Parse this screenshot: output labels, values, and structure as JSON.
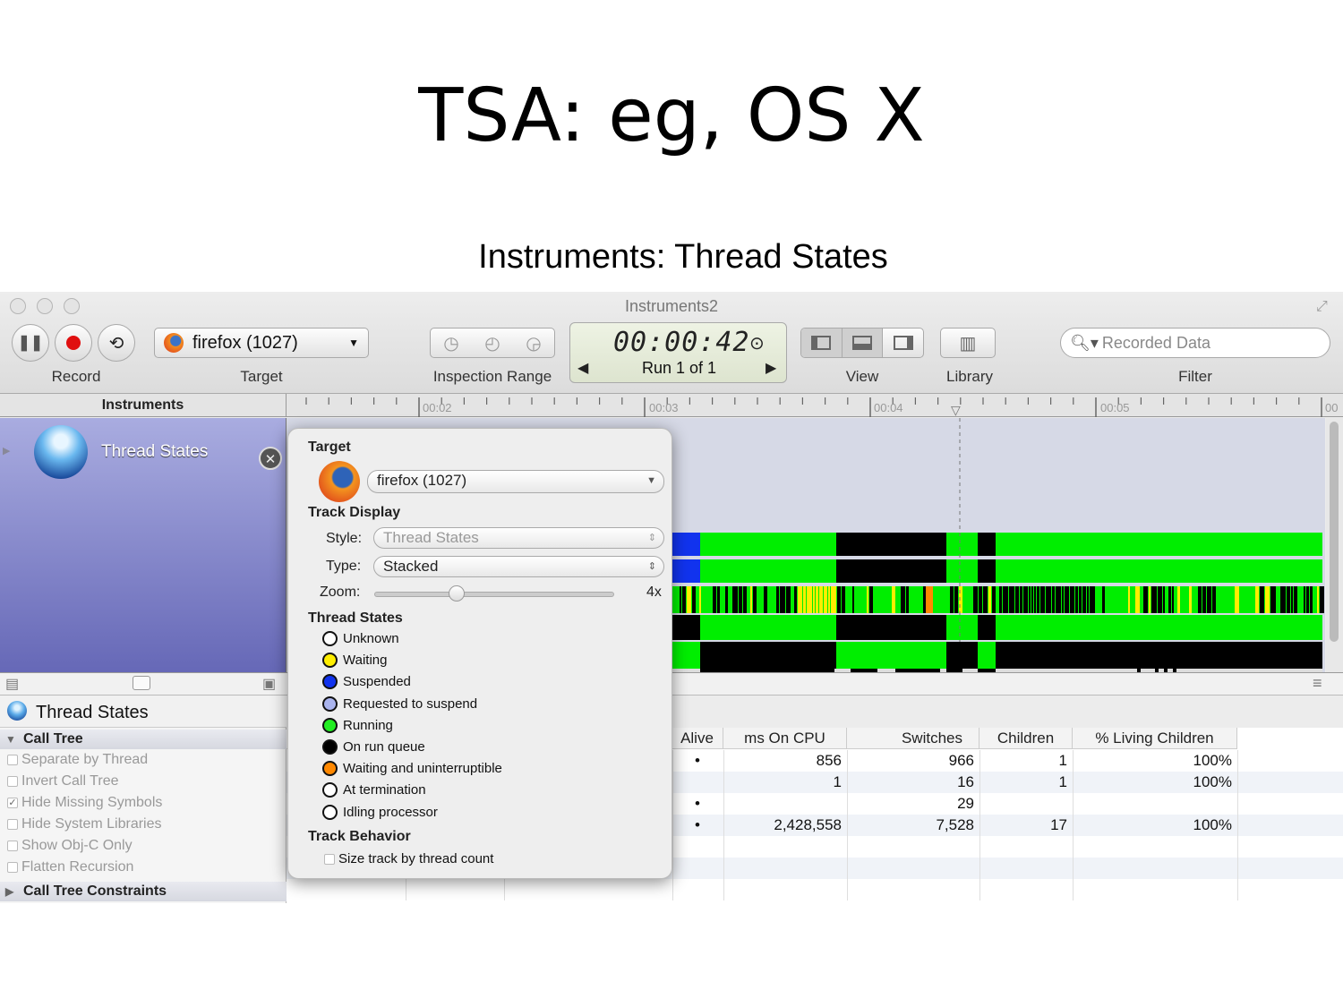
{
  "slide": {
    "title": "TSA: eg, OS X",
    "subtitle": "Instruments: Thread States"
  },
  "window": {
    "title": "Instruments2"
  },
  "toolbar": {
    "record_label": "Record",
    "target_label": "Target",
    "target_value": "firefox (1027)",
    "inspection_label": "Inspection Range",
    "time": "00:00:42",
    "run": "Run 1 of 1",
    "view_label": "View",
    "library_label": "Library",
    "filter_label": "Filter",
    "search_placeholder": "Recorded Data"
  },
  "ruler": {
    "header": "Instruments",
    "ticks": [
      "00:02",
      "00:03",
      "00:04",
      "00:05",
      "00"
    ]
  },
  "instrument": {
    "name": "Thread States"
  },
  "detail": {
    "title": "Thread States",
    "sections": [
      "Call Tree",
      "Call Tree Constraints"
    ],
    "options": [
      {
        "label": "Separate by Thread",
        "checked": false
      },
      {
        "label": "Invert Call Tree",
        "checked": false
      },
      {
        "label": "Hide Missing Symbols",
        "checked": true
      },
      {
        "label": "Hide System Libraries",
        "checked": false
      },
      {
        "label": "Show Obj-C Only",
        "checked": false
      },
      {
        "label": "Flatten Recursion",
        "checked": false
      }
    ]
  },
  "table": {
    "columns": [
      "Alive",
      "ms On CPU",
      "Switches",
      "Children",
      "% Living Children"
    ],
    "rows": [
      [
        "•",
        "856",
        "966",
        "1",
        "100%"
      ],
      [
        "",
        "1",
        "16",
        "1",
        "100%"
      ],
      [
        "•",
        "",
        "29",
        "",
        ""
      ],
      [
        "•",
        "2,428,558",
        "7,528",
        "17",
        "100%"
      ]
    ]
  },
  "popover": {
    "target_label": "Target",
    "target_value": "firefox (1027)",
    "track_display_label": "Track Display",
    "style_label": "Style:",
    "style_value": "Thread States",
    "type_label": "Type:",
    "type_value": "Stacked",
    "zoom_label": "Zoom:",
    "zoom_value": "4x",
    "zoom_level": 0.34,
    "thread_states_label": "Thread States",
    "states": [
      {
        "label": "Unknown",
        "color": "#ffffff"
      },
      {
        "label": "Waiting",
        "color": "#ffee00"
      },
      {
        "label": "Suspended",
        "color": "#1133ee"
      },
      {
        "label": "Requested to suspend",
        "color": "#aab4ee"
      },
      {
        "label": "Running",
        "color": "#22ee22"
      },
      {
        "label": "On run queue",
        "color": "#000000"
      },
      {
        "label": "Waiting and uninterruptible",
        "color": "#ff8800"
      },
      {
        "label": "At termination",
        "color": "#ffffff"
      },
      {
        "label": "Idling processor",
        "color": "#ffffff"
      }
    ],
    "track_behavior_label": "Track Behavior",
    "size_track_label": "Size track by thread count"
  }
}
